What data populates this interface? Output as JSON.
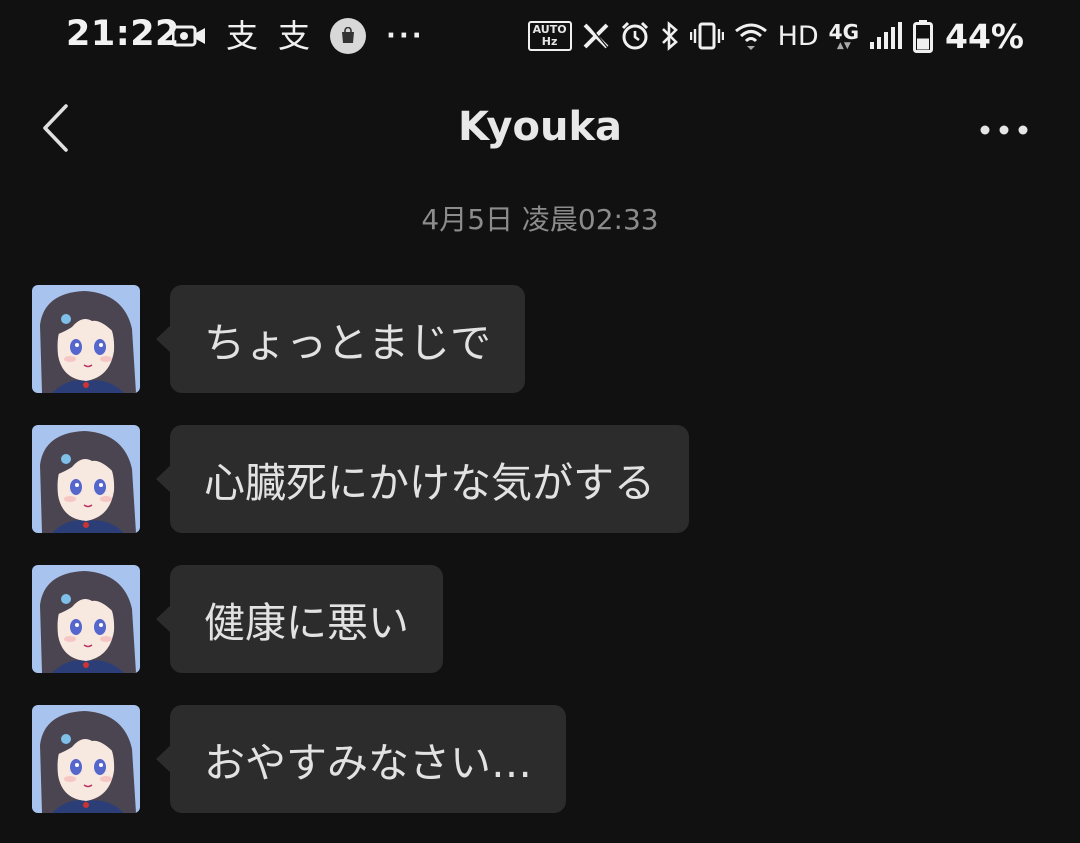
{
  "status_bar": {
    "time": "21:22",
    "left_icons": [
      "video-record-icon",
      "app-notification-icon",
      "app-notification-icon",
      "shopping-bag-icon",
      "more-notifications-icon"
    ],
    "notif_glyph": "支",
    "more_glyph": "···",
    "auto_label": "AUTO",
    "auto_sub": "Hz",
    "hd_label": "HD",
    "network_label": "4G",
    "battery_percent": "44%",
    "battery_level": 0.44
  },
  "header": {
    "title": "Kyouka",
    "back_icon": "chevron-left-icon",
    "more_icon": "more-horizontal-icon"
  },
  "timestamp": "4月5日 凌晨02:33",
  "messages": [
    {
      "sender": "Kyouka",
      "text": "ちょっとまじで"
    },
    {
      "sender": "Kyouka",
      "text": "心臓死にかけな気がする"
    },
    {
      "sender": "Kyouka",
      "text": "健康に悪い"
    },
    {
      "sender": "Kyouka",
      "text": "おやすみなさい…"
    }
  ],
  "colors": {
    "background": "#111111",
    "bubble": "#2c2c2c",
    "text": "#e2e2e2",
    "muted": "#8c8c8c",
    "avatar_bg": "#a9c3ef"
  }
}
